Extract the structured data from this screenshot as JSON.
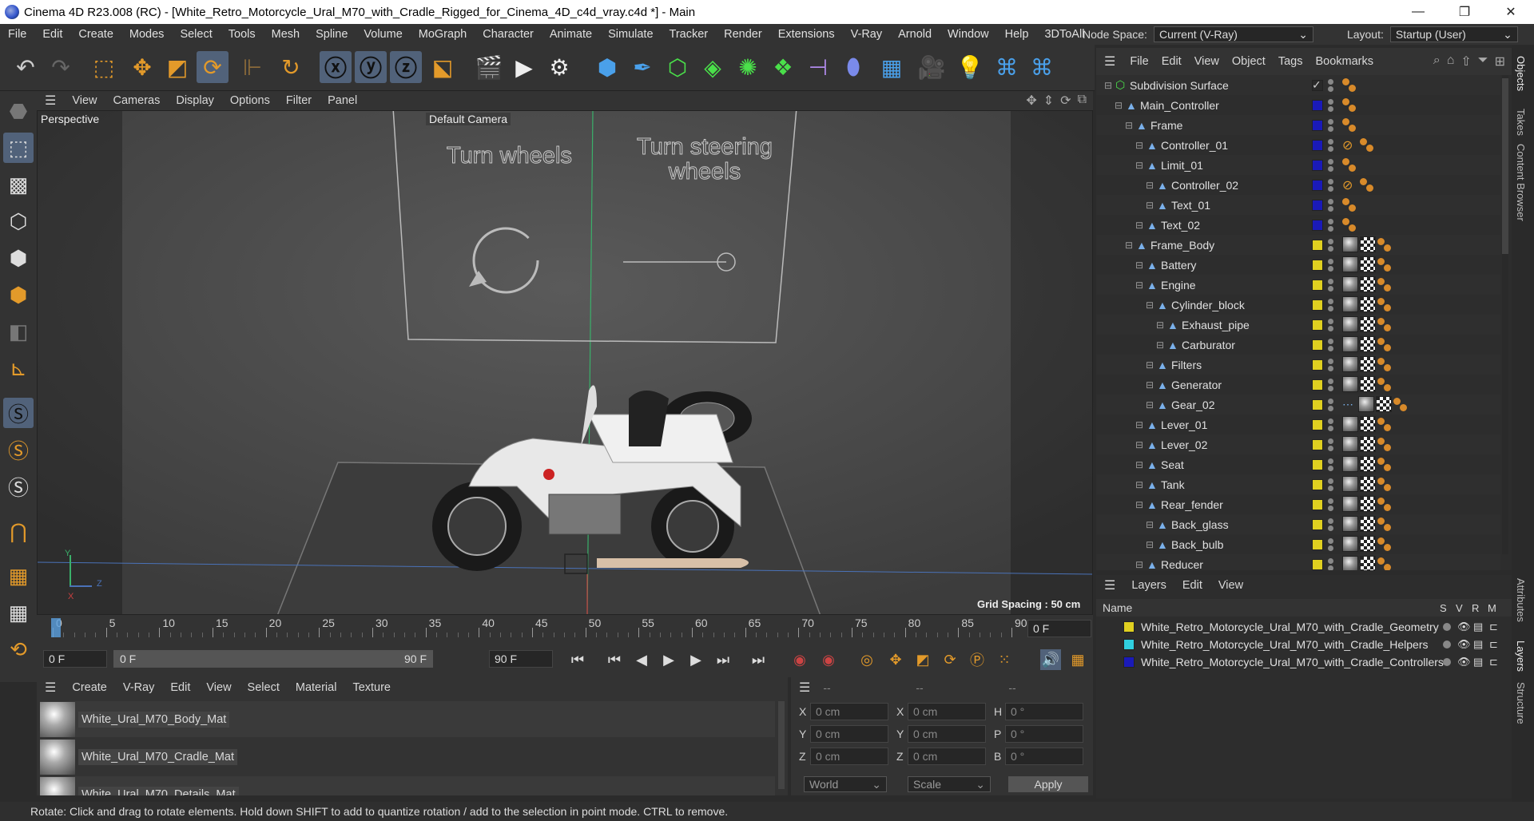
{
  "window": {
    "title": "Cinema 4D R23.008 (RC) - [White_Retro_Motorcycle_Ural_M70_with_Cradle_Rigged_for_Cinema_4D_c4d_vray.c4d *] - Main",
    "minimize": "—",
    "maximize": "❐",
    "close": "✕"
  },
  "menubar": {
    "items": [
      "File",
      "Edit",
      "Create",
      "Modes",
      "Select",
      "Tools",
      "Mesh",
      "Spline",
      "Volume",
      "MoGraph",
      "Character",
      "Animate",
      "Simulate",
      "Tracker",
      "Render",
      "Extensions",
      "V-Ray",
      "Arnold",
      "Window",
      "Help",
      "3DToAll"
    ],
    "node_space_label": "Node Space:",
    "node_space_value": "Current (V-Ray)",
    "layout_label": "Layout:",
    "layout_value": "Startup (User)"
  },
  "viewport": {
    "menu": [
      "View",
      "Cameras",
      "Display",
      "Options",
      "Filter",
      "Panel"
    ],
    "label": "Perspective",
    "camera": "Default Camera",
    "text_turn_wheels": "Turn wheels",
    "text_turn_steering_1": "Turn steering",
    "text_turn_steering_2": "wheels",
    "grid_spacing": "Grid Spacing : 50 cm",
    "axis_y": "Y",
    "axis_z": "Z",
    "axis_x": "X"
  },
  "timeline": {
    "ticks": [
      "0",
      "5",
      "10",
      "15",
      "20",
      "25",
      "30",
      "35",
      "40",
      "45",
      "50",
      "55",
      "60",
      "65",
      "70",
      "75",
      "80",
      "85",
      "90"
    ],
    "current_frame_right": "0 F",
    "start_frame": "0 F",
    "range_start": "0 F",
    "range_end": "90 F",
    "end_frame": "90 F"
  },
  "materials": {
    "menu": [
      "Create",
      "V-Ray",
      "Edit",
      "View",
      "Select",
      "Material",
      "Texture"
    ],
    "items": [
      "White_Ural_M70_Body_Mat",
      "White_Ural_M70_Cradle_Mat",
      "White_Ural_M70_Details_Mat"
    ]
  },
  "coords": {
    "headers": [
      "--",
      "--",
      "--"
    ],
    "rows": [
      {
        "a": "X",
        "av": "0 cm",
        "b": "X",
        "bv": "0 cm",
        "c": "H",
        "cv": "0 °"
      },
      {
        "a": "Y",
        "av": "0 cm",
        "b": "Y",
        "bv": "0 cm",
        "c": "P",
        "cv": "0 °"
      },
      {
        "a": "Z",
        "av": "0 cm",
        "b": "Z",
        "bv": "0 cm",
        "c": "B",
        "cv": "0 °"
      }
    ],
    "world": "World",
    "scale": "Scale",
    "apply": "Apply"
  },
  "status": "Rotate: Click and drag to rotate elements. Hold down SHIFT to add to quantize rotation / add to the selection in point mode. CTRL to remove.",
  "objects": {
    "menu": [
      "File",
      "Edit",
      "View",
      "Object",
      "Tags",
      "Bookmarks"
    ],
    "rows": [
      {
        "name": "Subdivision Surface",
        "indent": 0,
        "color": "#2a2a2a",
        "kind": "sub"
      },
      {
        "name": "Main_Controller",
        "indent": 1,
        "color": "#1a1ab8",
        "kind": "c"
      },
      {
        "name": "Frame",
        "indent": 2,
        "color": "#1a1ab8",
        "kind": "c"
      },
      {
        "name": "Controller_01",
        "indent": 3,
        "color": "#1a1ab8",
        "kind": "cx"
      },
      {
        "name": "Limit_01",
        "indent": 3,
        "color": "#1a1ab8",
        "kind": "c"
      },
      {
        "name": "Controller_02",
        "indent": 4,
        "color": "#1a1ab8",
        "kind": "cx"
      },
      {
        "name": "Text_01",
        "indent": 4,
        "color": "#1a1ab8",
        "kind": "c"
      },
      {
        "name": "Text_02",
        "indent": 3,
        "color": "#1a1ab8",
        "kind": "c"
      },
      {
        "name": "Frame_Body",
        "indent": 2,
        "color": "#e0d020",
        "kind": "m"
      },
      {
        "name": "Battery",
        "indent": 3,
        "color": "#e0d020",
        "kind": "m"
      },
      {
        "name": "Engine",
        "indent": 3,
        "color": "#e0d020",
        "kind": "m"
      },
      {
        "name": "Cylinder_block",
        "indent": 4,
        "color": "#e0d020",
        "kind": "m"
      },
      {
        "name": "Exhaust_pipe",
        "indent": 5,
        "color": "#e0d020",
        "kind": "m"
      },
      {
        "name": "Carburator",
        "indent": 5,
        "color": "#e0d020",
        "kind": "m"
      },
      {
        "name": "Filters",
        "indent": 4,
        "color": "#e0d020",
        "kind": "m"
      },
      {
        "name": "Generator",
        "indent": 4,
        "color": "#e0d020",
        "kind": "m"
      },
      {
        "name": "Gear_02",
        "indent": 4,
        "color": "#e0d020",
        "kind": "mg"
      },
      {
        "name": "Lever_01",
        "indent": 3,
        "color": "#e0d020",
        "kind": "m"
      },
      {
        "name": "Lever_02",
        "indent": 3,
        "color": "#e0d020",
        "kind": "m"
      },
      {
        "name": "Seat",
        "indent": 3,
        "color": "#e0d020",
        "kind": "m"
      },
      {
        "name": "Tank",
        "indent": 3,
        "color": "#e0d020",
        "kind": "m"
      },
      {
        "name": "Rear_fender",
        "indent": 3,
        "color": "#e0d020",
        "kind": "m"
      },
      {
        "name": "Back_glass",
        "indent": 4,
        "color": "#e0d020",
        "kind": "m"
      },
      {
        "name": "Back_bulb",
        "indent": 4,
        "color": "#e0d020",
        "kind": "m"
      },
      {
        "name": "Reducer",
        "indent": 3,
        "color": "#e0d020",
        "kind": "m"
      }
    ]
  },
  "layers": {
    "menu": [
      "Layers",
      "Edit",
      "View"
    ],
    "col_name": "Name",
    "cols": [
      "S",
      "V",
      "R",
      "M"
    ],
    "items": [
      {
        "name": "White_Retro_Motorcycle_Ural_M70_with_Cradle_Geometry",
        "color": "#e0d020"
      },
      {
        "name": "White_Retro_Motorcycle_Ural_M70_with_Cradle_Helpers",
        "color": "#30d0e0"
      },
      {
        "name": "White_Retro_Motorcycle_Ural_M70_with_Cradle_Controllers",
        "color": "#1a1ab8"
      }
    ]
  },
  "right_tabs": [
    "Objects",
    "Takes",
    "Content Browser",
    "Attributes",
    "Layers",
    "Structure"
  ]
}
